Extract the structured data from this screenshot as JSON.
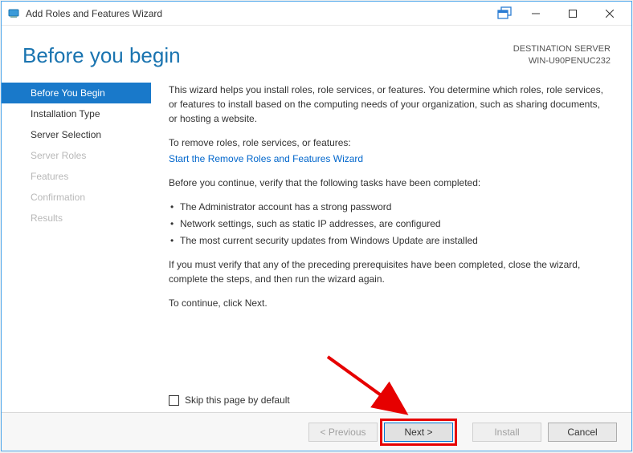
{
  "window": {
    "title": "Add Roles and Features Wizard"
  },
  "header": {
    "page_title": "Before you begin",
    "destination_label": "DESTINATION SERVER",
    "destination_server": "WIN-U90PENUC232"
  },
  "sidebar": {
    "steps": [
      {
        "label": "Before You Begin",
        "state": "active"
      },
      {
        "label": "Installation Type",
        "state": "enabled"
      },
      {
        "label": "Server Selection",
        "state": "enabled"
      },
      {
        "label": "Server Roles",
        "state": "disabled"
      },
      {
        "label": "Features",
        "state": "disabled"
      },
      {
        "label": "Confirmation",
        "state": "disabled"
      },
      {
        "label": "Results",
        "state": "disabled"
      }
    ]
  },
  "content": {
    "intro": "This wizard helps you install roles, role services, or features. You determine which roles, role services, or features to install based on the computing needs of your organization, such as sharing documents, or hosting a website.",
    "remove_intro": "To remove roles, role services, or features:",
    "remove_link": "Start the Remove Roles and Features Wizard",
    "verify_intro": "Before you continue, verify that the following tasks have been completed:",
    "bullets": [
      "The Administrator account has a strong password",
      "Network settings, such as static IP addresses, are configured",
      "The most current security updates from Windows Update are installed"
    ],
    "must_verify": "If you must verify that any of the preceding prerequisites have been completed, close the wizard, complete the steps, and then run the wizard again.",
    "continue": "To continue, click Next.",
    "skip_label": "Skip this page by default"
  },
  "footer": {
    "previous": "< Previous",
    "next": "Next >",
    "install": "Install",
    "cancel": "Cancel"
  }
}
